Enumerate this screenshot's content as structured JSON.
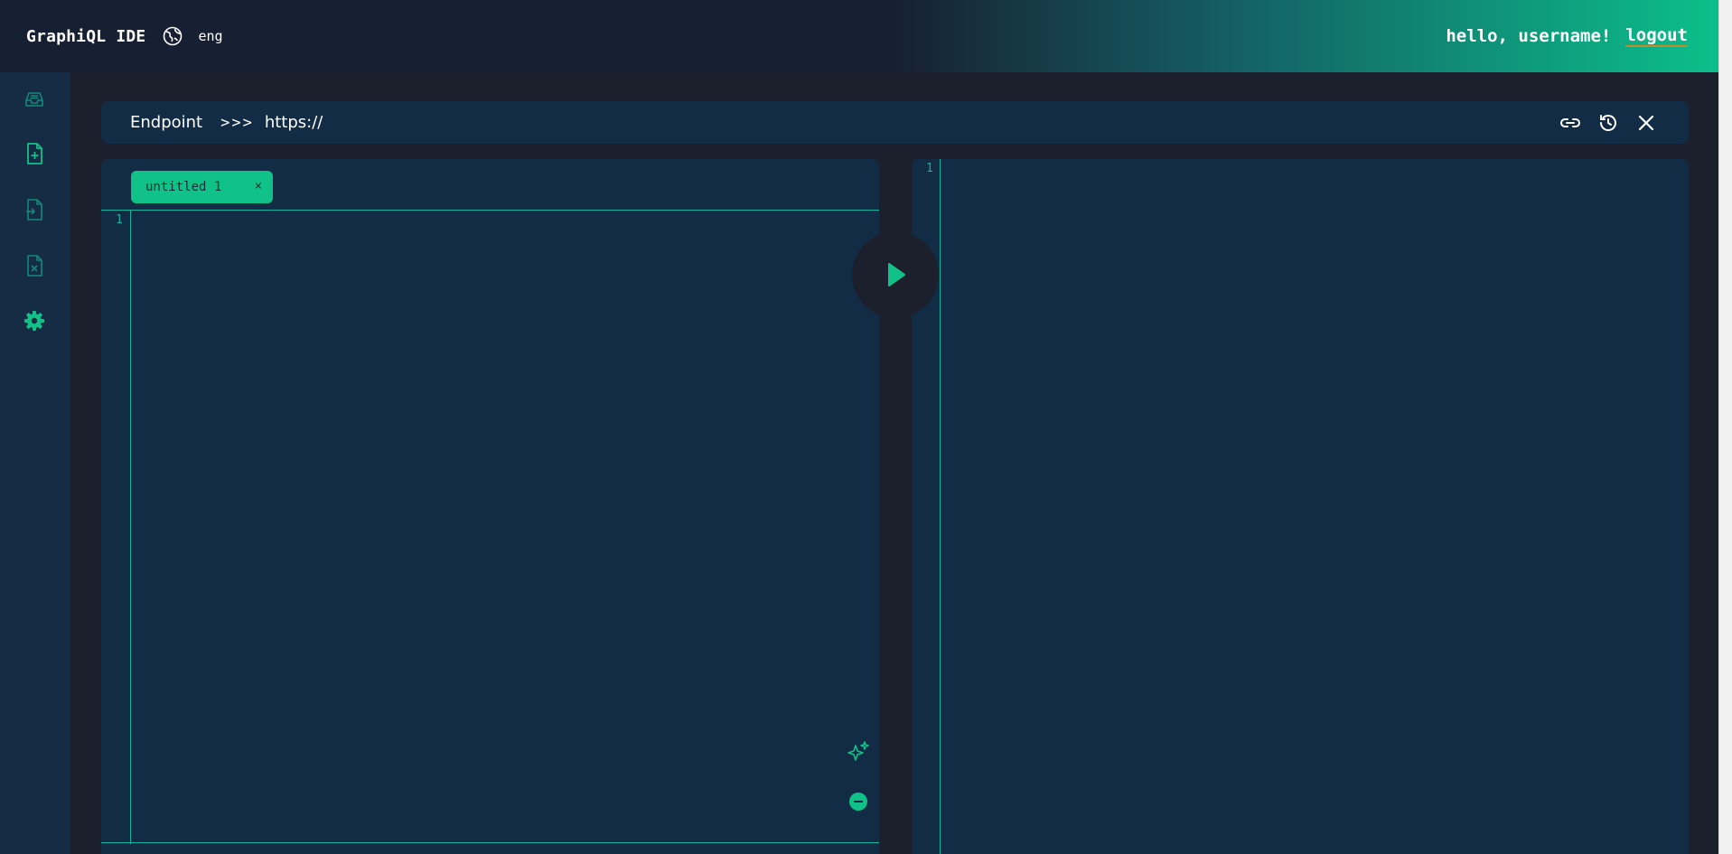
{
  "header": {
    "app_title": "GraphiQL IDE",
    "lang_label": "eng",
    "greeting": "hello, username!",
    "logout_label": "logout"
  },
  "sidebar": {
    "items": [
      {
        "name": "inbox-icon"
      },
      {
        "name": "add-file-icon"
      },
      {
        "name": "export-file-icon"
      },
      {
        "name": "delete-file-icon"
      },
      {
        "name": "gear-icon"
      }
    ]
  },
  "endpoint": {
    "label": "Endpoint",
    "arrows": ">>>",
    "value": "https://",
    "actions": [
      "link-icon",
      "history-icon",
      "close-icon"
    ]
  },
  "query_editor": {
    "tab_label": "untitled 1",
    "tab_close": "×",
    "line_number": "1"
  },
  "result_editor": {
    "line_number": "1"
  },
  "colors": {
    "accent": "#11c288",
    "panel": "#132c46",
    "background": "#1b202c",
    "sidebar": "#162b44"
  }
}
